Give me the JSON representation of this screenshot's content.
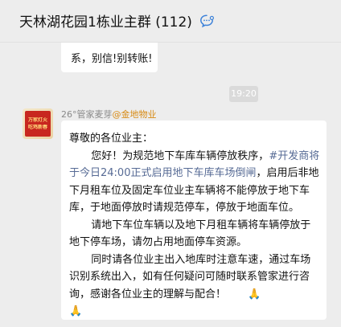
{
  "header": {
    "title": "天林湖花园1栋业主群 (112)",
    "icon": "chat-bubble-icon"
  },
  "previous_message": {
    "text": "系，别信!别转账!"
  },
  "timestamp": "19:20",
  "message": {
    "sender_name": "26°管家麦芽",
    "sender_org": "@金地物业",
    "avatar_text": [
      "万家灯火",
      "吃鸡新春"
    ],
    "greeting": "尊敬的各位业主：",
    "p1_start": "您好！为规范地下车库车辆停放秩序，",
    "p1_tag": "#开发商将于今日24:00正式启用地下车库车场倒闸",
    "p1_end": "，启用后非地下月租车位及固定车位业主车辆将不能停放于地下车库，于地面停放时请规范停车，停放于地面车位。",
    "p2": "请地下车位车辆以及地下月租车辆将车辆停放于地下停车场，请勿占用地面停车资源。",
    "p3": "同时请各位业主出入地库时注意车速，通过车场识别系统出入，如有任何疑问可随时联系管家进行咨询，感谢各位业主的理解与配合！",
    "emoji": "🙏",
    "emoji_name": "pray-icon"
  },
  "colors": {
    "background": "#ededed",
    "bubble": "#ffffff",
    "tag": "#576b95",
    "org": "#d78a14"
  }
}
